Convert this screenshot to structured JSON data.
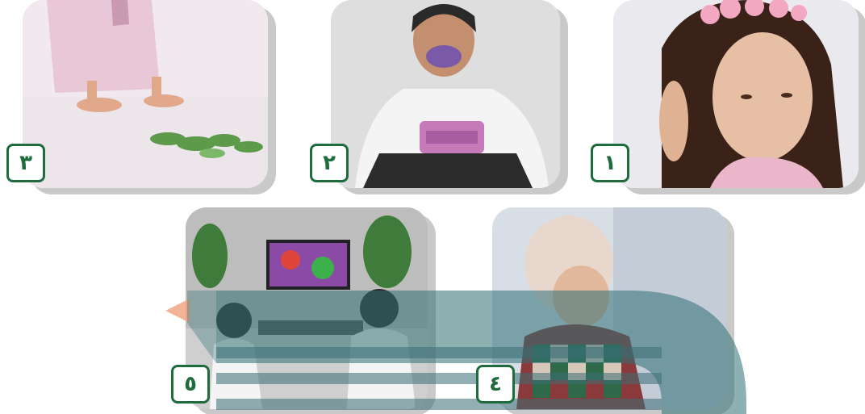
{
  "cards": [
    {
      "number": "٣",
      "scene": "feet-walking-on-leaves"
    },
    {
      "number": "٢",
      "scene": "child-tasting-food"
    },
    {
      "number": "١",
      "scene": "girl-touching-ear"
    },
    {
      "number": "٥",
      "scene": "children-watching-tv"
    },
    {
      "number": "٤",
      "scene": "child-smelling"
    }
  ],
  "colors": {
    "number_accent": "#1e6b3c",
    "watermark": "#2f6f75"
  }
}
